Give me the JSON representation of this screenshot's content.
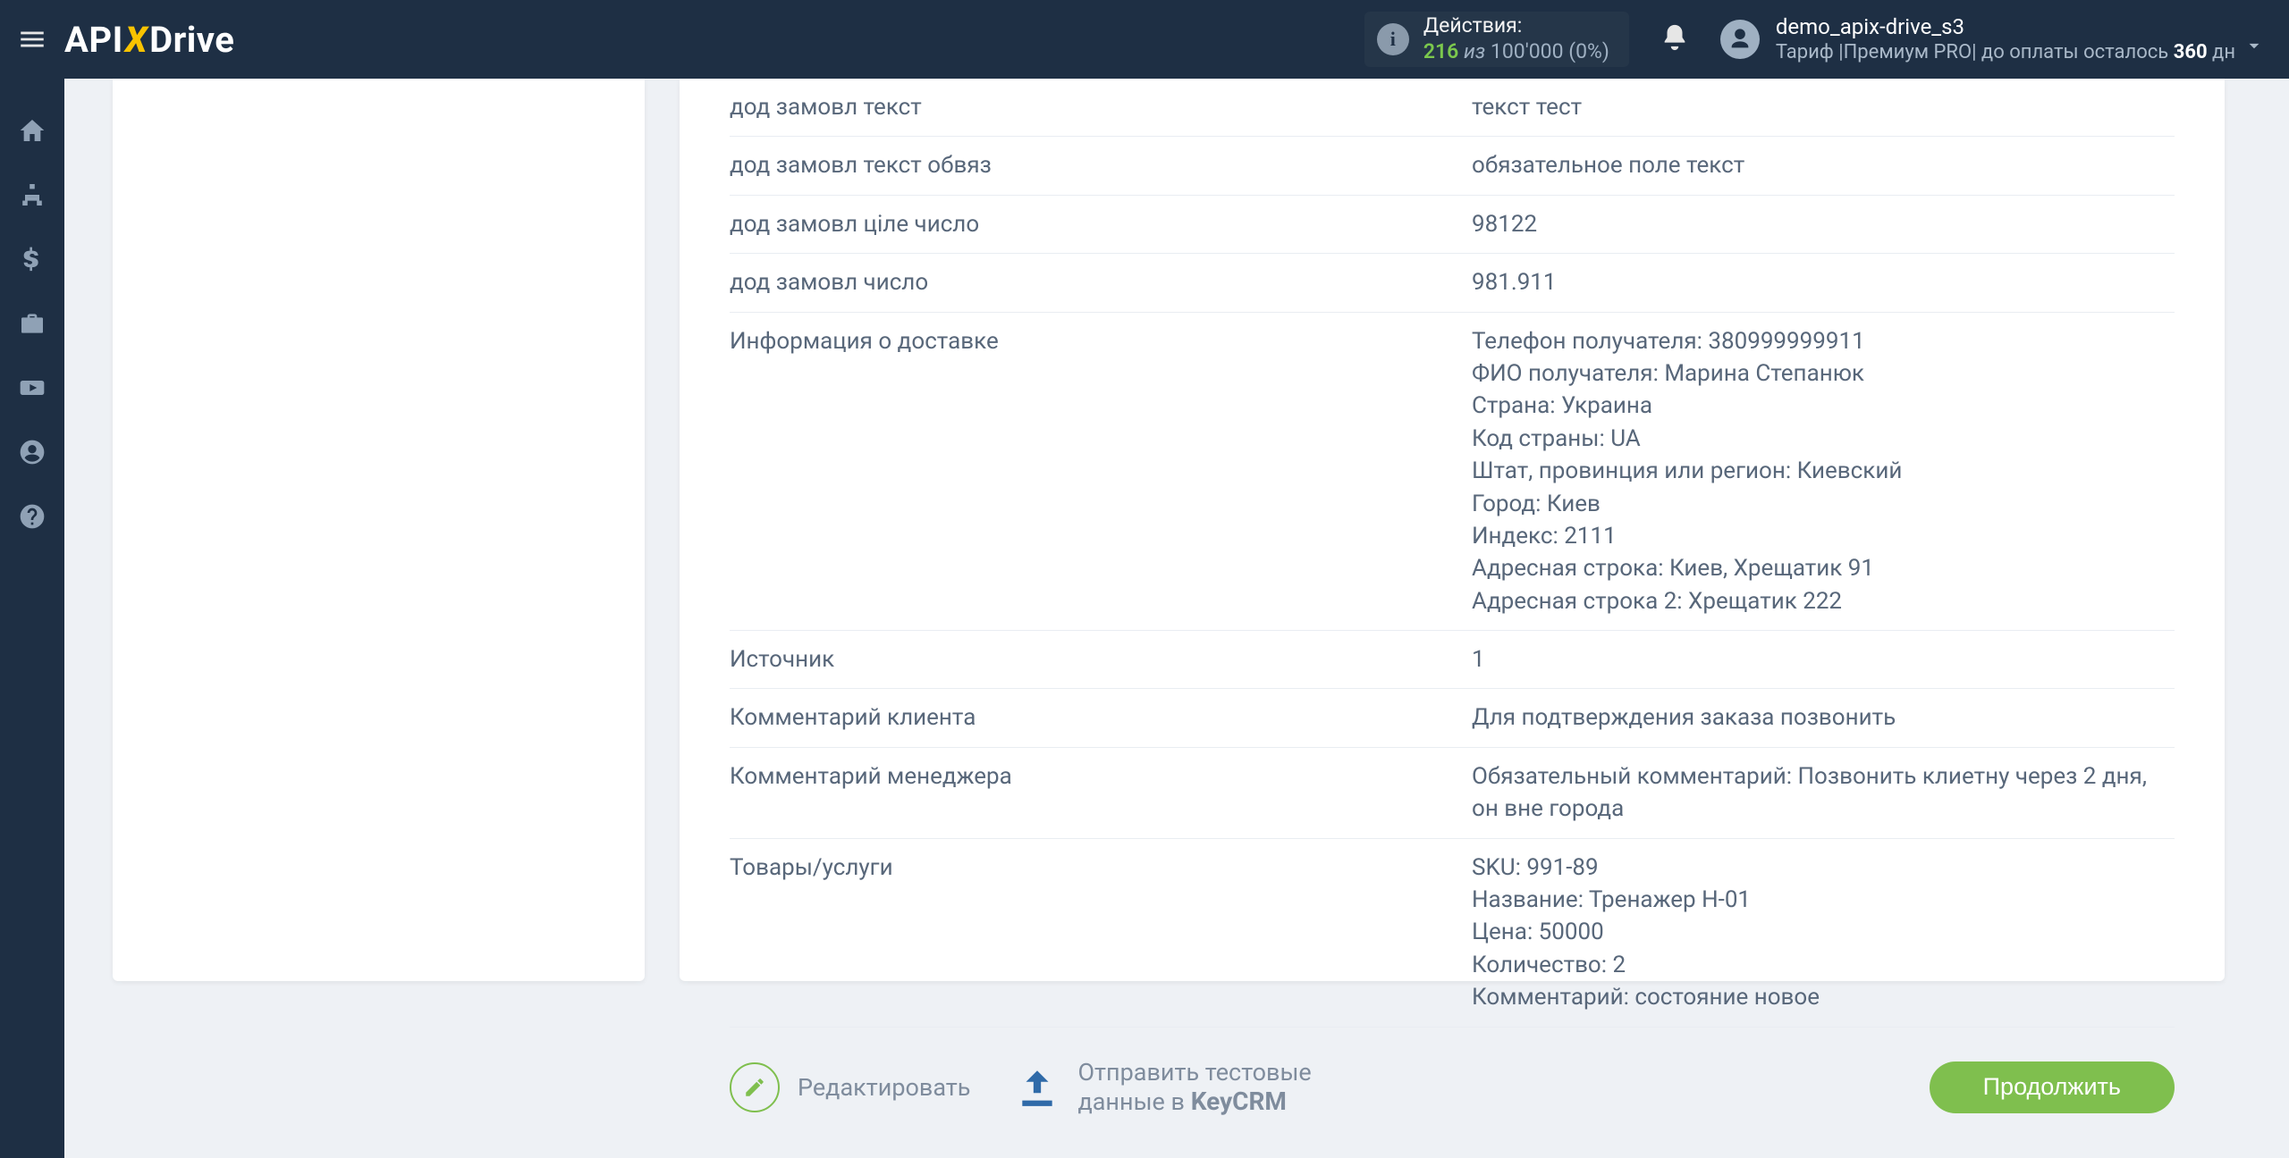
{
  "header": {
    "logo_api": "API",
    "logo_x": "X",
    "logo_drive": "Drive",
    "actions_label": "Действия:",
    "actions_used": "216",
    "actions_of": "из",
    "actions_max": "100'000",
    "actions_pct": "(0%)",
    "user_name": "demo_apix-drive_s3",
    "plan_prefix": "Тариф |",
    "plan_name": "Премиум PRO",
    "plan_mid": "| до оплаты осталось ",
    "plan_days": "360",
    "plan_days_suffix": " дн"
  },
  "table": {
    "rows": [
      {
        "label": "дод замовл текст",
        "value": "текст тест"
      },
      {
        "label": "дод замовл текст обвяз",
        "value": "обязательное поле текст"
      },
      {
        "label": "дод замовл ціле число",
        "value": "98122"
      },
      {
        "label": "дод замовл число",
        "value": "981.911"
      },
      {
        "label": "Информация о доставке",
        "value": "Телефон получателя: 380999999911\nФИО получателя: Марина Степанюк\nСтрана: Украина\nКод страны: UA\nШтат, провинция или регион: Киевский\nГород: Киев\nИндекс: 2111\nАдресная строка: Киев, Хрещатик 91\nАдресная строка 2: Хрещатик 222"
      },
      {
        "label": "Источник",
        "value": "1"
      },
      {
        "label": "Комментарий клиента",
        "value": "Для подтверждения заказа позвонить"
      },
      {
        "label": "Комментарий менеджера",
        "value": "Обязательный комментарий: Позвонить клиетну через 2 дня, он вне города"
      },
      {
        "label": "Товары/услуги",
        "value": "SKU: 991-89\nНазвание: Тренажер H-01\nЦена: 50000\nКоличество: 2\nКомментарий: состояние новое"
      }
    ]
  },
  "footer": {
    "edit_label": "Редактировать",
    "send_line1": "Отправить тестовые",
    "send_line2_prefix": "данные в ",
    "send_brand": "KeyCRM",
    "continue": "Продолжить"
  }
}
